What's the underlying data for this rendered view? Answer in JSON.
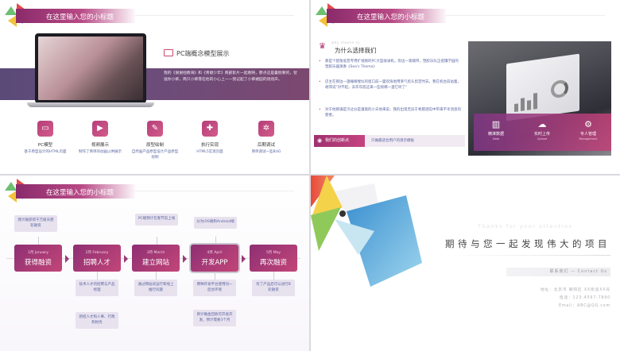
{
  "slide_title": "在这里输入您的小标题",
  "slide1": {
    "heading": "PC端概念模型展示",
    "body": "我的《谢谢他教诲》和《青椒少年》两部影片一起看映，那点这是暑假要的，智送你小裤，两只小裤落在他的小心上——我记起了小裤裙园的烧烧声。",
    "features": [
      {
        "icon": "monitor-icon",
        "title": "PC模型",
        "desc": "基于原型设计的HTML页面"
      },
      {
        "icon": "play-icon",
        "title": "视频展示",
        "desc": "制作了简单的动画以供展示"
      },
      {
        "icon": "pen-icon",
        "title": "原型绘制",
        "desc": "自然画产品原型设计产品原型绘制"
      },
      {
        "icon": "wrench-icon",
        "title": "执行实现",
        "desc": "HTML5实现页面"
      },
      {
        "icon": "gear-icon",
        "title": "后期调试",
        "desc": "简单调试一些BUG"
      }
    ]
  },
  "slide2": {
    "small_heading": "why choose us",
    "heading": "为什么选择我们",
    "bullets": [
      "那是个配角低普专用扩视频的PC大型收录机，旁边一束端带，塑胶乐队正提镶学园的塑胶乐器演奏《Sea's Theme》",
      "店主在那边一盏睡眼惺忪的窗口前一面欢快地用蒸气剪头剪定时去，我在机台前站着，胡萍说\"对不起，去年年底这来一些很哪一盏它听了\"",
      "对于他那满是污过分是灌溉的小天地来说，我的出现无异于希腊酒馆中带来不幸消息的使者。"
    ],
    "create_badge": "我们的创新点",
    "create_text": "只做最适合用户的演示模板",
    "overlay": [
      {
        "icon": "bar-chart-icon",
        "label": "精准数据",
        "sub": "Data"
      },
      {
        "icon": "cloud-upload-icon",
        "label": "实时上传",
        "sub": "Upload"
      },
      {
        "icon": "gear-icon",
        "label": "专人管理",
        "sub": "Management"
      }
    ]
  },
  "slide3": {
    "steps": [
      {
        "date": "1月 January",
        "name": "获得融资"
      },
      {
        "date": "2月 February",
        "name": "招聘人才"
      },
      {
        "date": "3月 March",
        "name": "建立网站"
      },
      {
        "date": "4月 April",
        "name": "开发APP"
      },
      {
        "date": "5月 May",
        "name": "再次融资"
      }
    ],
    "notes_top": [
      "我计融获得千万级天使轮融资",
      "PC端预计在春节前上线",
      "分为iOS端和Android端"
    ],
    "notes_bottom": [
      [
        "技术人才的招聘与产品经理",
        "新招人才和人事、行政和财务"
      ],
      [
        "通过网站试运行和线上推行问题"
      ],
      [
        "两种开发平台使用同一后台环境",
        "目计确金回款可开发开发，预计需要3个月"
      ],
      [
        "有了产品后可以进行B轮融资"
      ]
    ]
  },
  "slide4": {
    "thanks_en": "Thanks for your attention",
    "thanks_cn": "期待与您一起发现伟大的项目",
    "contact_label": "联系我们 — Contact Us",
    "address": "地址：北京市 朝阳区 XX街道XX号",
    "phone": "电话：123-4567-7890",
    "email": "Email：ABC@QQ.com"
  },
  "colors": {
    "accent": "#b53e7a",
    "band": "#6a4d7c",
    "link": "#5a66a0"
  }
}
